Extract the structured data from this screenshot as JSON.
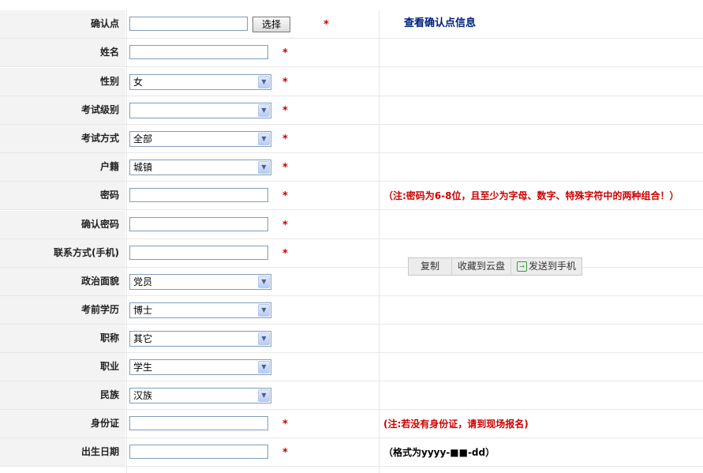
{
  "form": {
    "rows": [
      {
        "label": "确认点",
        "type": "text",
        "value": "",
        "required": true,
        "button": "选择",
        "link": "查看确认点信息"
      },
      {
        "label": "姓名",
        "type": "text",
        "value": "",
        "required": true
      },
      {
        "label": "性别",
        "type": "select",
        "value": "女",
        "required": true
      },
      {
        "label": "考试级别",
        "type": "select",
        "value": "",
        "required": true
      },
      {
        "label": "考试方式",
        "type": "select",
        "value": "全部",
        "required": true
      },
      {
        "label": "户籍",
        "type": "select",
        "value": "城镇",
        "required": true
      },
      {
        "label": "密码",
        "type": "text",
        "value": "",
        "required": true,
        "note": "（注:密码为6-8位，且至少为字母、数字、特殊字符中的两种组合！）",
        "note_color": "red"
      },
      {
        "label": "确认密码",
        "type": "text",
        "value": "",
        "required": true
      },
      {
        "label": "联系方式(手机)",
        "type": "text",
        "value": "",
        "required": true
      },
      {
        "label": "政治面貌",
        "type": "select",
        "value": "党员",
        "required": false
      },
      {
        "label": "考前学历",
        "type": "select",
        "value": "博士",
        "required": false
      },
      {
        "label": "职称",
        "type": "select",
        "value": "其它",
        "required": false
      },
      {
        "label": "职业",
        "type": "select",
        "value": "学生",
        "required": false
      },
      {
        "label": "民族",
        "type": "select",
        "value": "汉族",
        "required": false
      },
      {
        "label": "身份证",
        "type": "text",
        "value": "",
        "required": true,
        "note": "(注:若没有身份证，请到现场报名)",
        "note_color": "red"
      },
      {
        "label": "出生日期",
        "type": "text",
        "value": "",
        "required": true,
        "note": "（格式为yyyy-■■-dd）",
        "note_color": "black"
      }
    ],
    "required_mark": "*"
  },
  "context_menu": {
    "items": [
      "复制",
      "收藏到云盘",
      "发送到手机"
    ],
    "icons": [
      "",
      "",
      "send-to-phone-icon"
    ]
  },
  "colors": {
    "required": "#cc0000",
    "link": "#00207f",
    "label_bg": "#f3f3f3"
  }
}
